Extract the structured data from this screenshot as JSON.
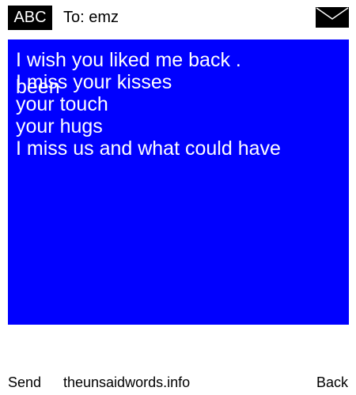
{
  "header": {
    "input_mode": "ABC",
    "recipient": "To: emz",
    "envelope_icon": "envelope-icon"
  },
  "message": {
    "body": "I wish you liked me back .\nI miss your kisses\nyour touch\nyour hugs\nI miss us and what could have",
    "overflow": "been",
    "background_color": "#0000ff",
    "text_color": "#ffffff"
  },
  "footer": {
    "send_label": "Send",
    "site_label": "theunsaidwords.info",
    "back_label": "Back"
  }
}
